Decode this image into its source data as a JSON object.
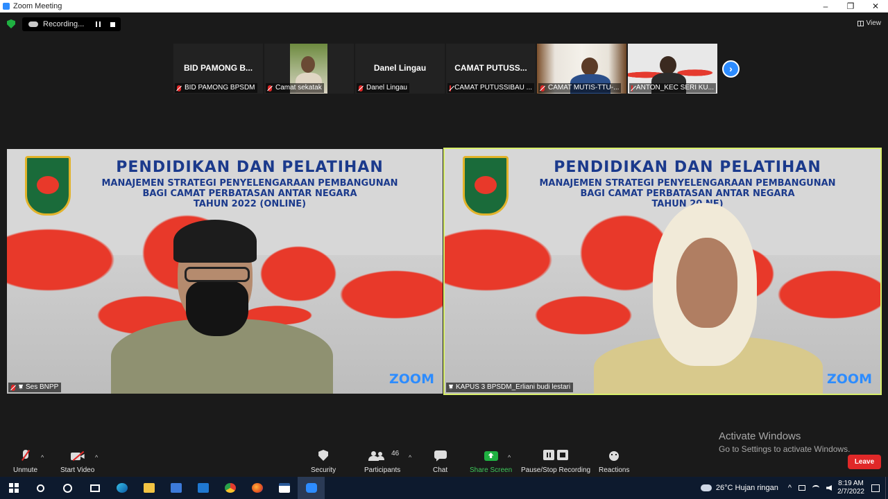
{
  "window": {
    "title": "Zoom Meeting",
    "controls": [
      "–",
      "❐",
      "✕"
    ]
  },
  "topbar": {
    "recording_label": "Recording...",
    "view_label": "View"
  },
  "thumbnails": [
    {
      "big_name": "BID PAMONG B...",
      "label": "BID PAMONG BPSDM"
    },
    {
      "big_name": "",
      "label": "Camat sekatak"
    },
    {
      "big_name": "Danel Lingau",
      "label": "Danel Lingau"
    },
    {
      "big_name": "CAMAT  PUTUSS...",
      "label": "CAMAT PUTUSSIBAU ..."
    },
    {
      "big_name": "",
      "label": "CAMAT MUTIS-TTU-..."
    },
    {
      "big_name": "",
      "label": "ANTON_KEC SERI KU..."
    }
  ],
  "slide": {
    "line1": "PENDIDIKAN DAN PELATIHAN",
    "line2": "MANAJEMEN STRATEGI PENYELENGARAAN PEMBANGUNAN",
    "line3": "BAGI CAMAT PERBATASAN ANTAR NEGARA",
    "line4_left": "TAHUN 2022 (ONLINE)",
    "line4_right": "TAHUN 20       NE)",
    "watermark": "ZOOM"
  },
  "tiles": {
    "left_label": "Ses BNPP",
    "right_label": "KAPUS 3 BPSDM_Erliani budi lestari"
  },
  "activate": {
    "line1": "Activate Windows",
    "line2": "Go to Settings to activate Windows."
  },
  "toolbar": {
    "unmute": "Unmute",
    "start_video": "Start Video",
    "security": "Security",
    "participants": "Participants",
    "participants_count": "46",
    "chat": "Chat",
    "share_screen": "Share Screen",
    "pause_recording": "Pause/Stop Recording",
    "reactions": "Reactions",
    "leave": "Leave"
  },
  "taskbar": {
    "weather": "26°C  Hujan ringan",
    "time": "8:19 AM",
    "date": "2/7/2022"
  },
  "colors": {
    "zoom_blue": "#2D8CFF",
    "active_speaker": "#d9f06a",
    "leave_red": "#e02828",
    "share_green": "#1fb141"
  }
}
